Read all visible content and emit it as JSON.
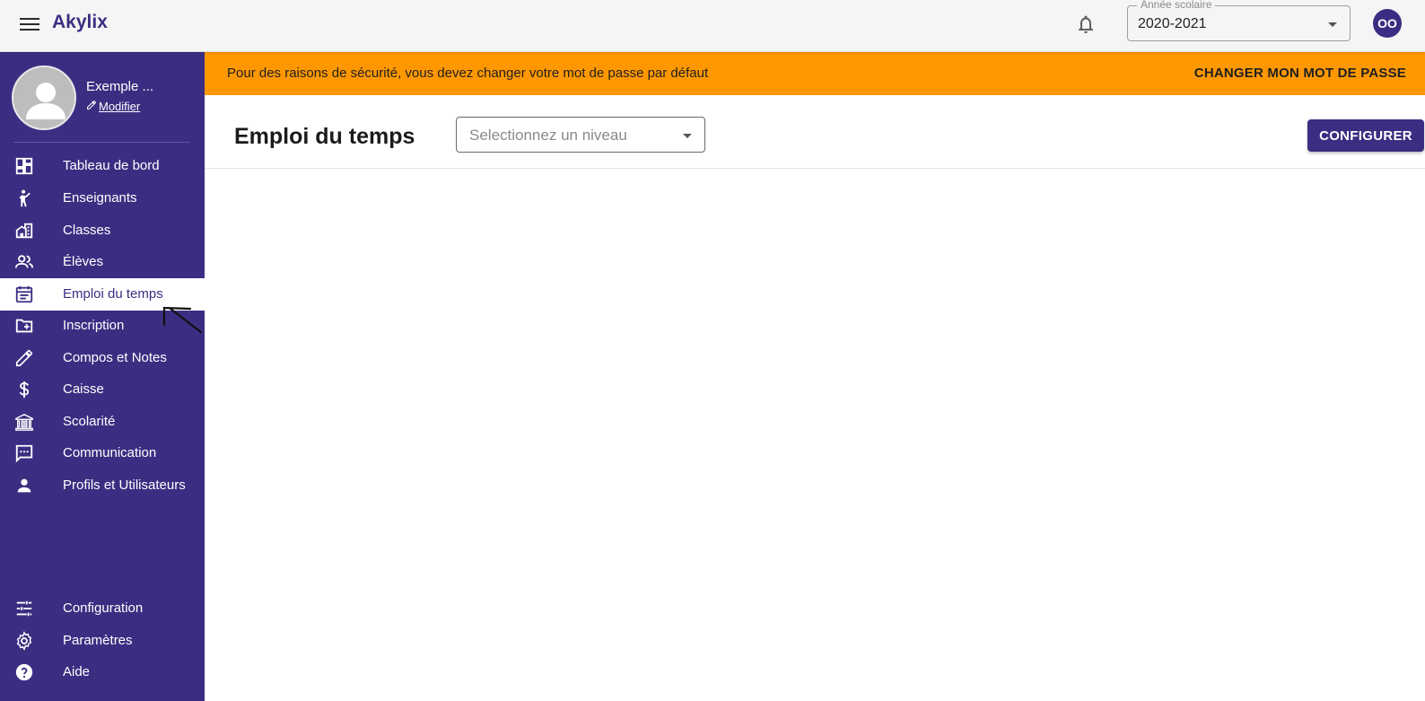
{
  "app": {
    "brand": "Akylix"
  },
  "topbar": {
    "year_select": {
      "legend": "Année scolaire",
      "value": "2020-2021"
    },
    "avatar_initials": "OO",
    "notification_icon": "bell-icon"
  },
  "profile": {
    "name": "Exemple ...",
    "edit_label": "Modifier"
  },
  "sidebar": {
    "items": [
      {
        "label": "Tableau de bord",
        "icon": "dashboard-icon"
      },
      {
        "label": "Enseignants",
        "icon": "teacher-icon"
      },
      {
        "label": "Classes",
        "icon": "building-icon"
      },
      {
        "label": "Élèves",
        "icon": "students-icon"
      },
      {
        "label": "Emploi du temps",
        "icon": "calendar-icon",
        "active": true
      },
      {
        "label": "Inscription",
        "icon": "folder-plus-icon"
      },
      {
        "label": "Compos et Notes",
        "icon": "pencil-icon"
      },
      {
        "label": "Caisse",
        "icon": "dollar-icon"
      },
      {
        "label": "Scolarité",
        "icon": "bank-icon"
      },
      {
        "label": "Communication",
        "icon": "message-icon"
      },
      {
        "label": "Profils et Utilisateurs",
        "icon": "person-icon"
      }
    ],
    "bottom_items": [
      {
        "label": "Configuration",
        "icon": "sliders-icon"
      },
      {
        "label": "Paramètres",
        "icon": "gear-icon"
      },
      {
        "label": "Aide",
        "icon": "help-icon"
      }
    ]
  },
  "banner": {
    "message": "Pour des raisons de sécurité, vous devez changer votre mot de passe par défaut",
    "action_label": "CHANGER MON MOT DE PASSE"
  },
  "page": {
    "title": "Emploi du temps",
    "level_select": {
      "placeholder": "Selectionnez un niveau"
    },
    "configure_label": "CONFIGURER"
  },
  "colors": {
    "primary": "#3b2e82",
    "banner": "#ff9800",
    "topbar": "#f5f5f5"
  }
}
